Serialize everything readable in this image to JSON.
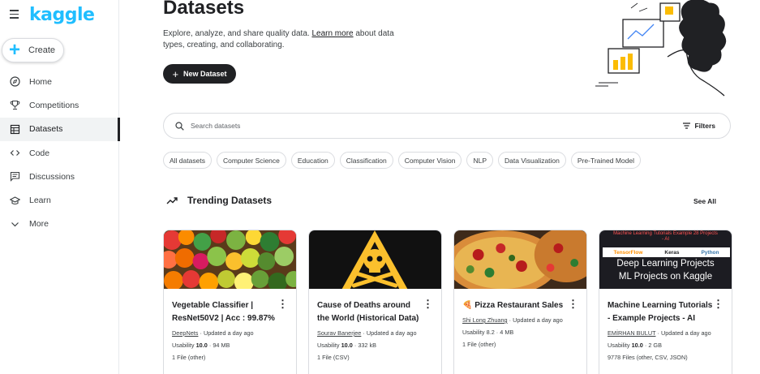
{
  "app": {
    "logo": "kaggle"
  },
  "sidebar": {
    "create_label": "Create",
    "items": [
      {
        "label": "Home",
        "icon": "compass-icon"
      },
      {
        "label": "Competitions",
        "icon": "trophy-icon"
      },
      {
        "label": "Datasets",
        "icon": "table-icon",
        "active": true
      },
      {
        "label": "Code",
        "icon": "code-icon"
      },
      {
        "label": "Discussions",
        "icon": "comment-icon"
      },
      {
        "label": "Learn",
        "icon": "graduation-cap-icon"
      },
      {
        "label": "More",
        "icon": "chevron-down-icon"
      }
    ]
  },
  "header": {
    "title": "Datasets",
    "desc_before": "Explore, analyze, and share quality data. ",
    "desc_link": "Learn more",
    "desc_after": " about data types, creating, and collaborating.",
    "new_dataset_label": "New Dataset"
  },
  "search": {
    "placeholder": "Search datasets",
    "filters_label": "Filters"
  },
  "chips": [
    "All datasets",
    "Computer Science",
    "Education",
    "Classification",
    "Computer Vision",
    "NLP",
    "Data Visualization",
    "Pre-Trained Model"
  ],
  "trending": {
    "title": "Trending Datasets",
    "see_all": "See All",
    "cards": [
      {
        "title": "Vegetable Classifier | ResNet50V2 | Acc : 99.87%",
        "author": "DeepNets",
        "updated": "Updated a day ago",
        "usability_label": "Usability",
        "usability": "10.0",
        "size": "94 MB",
        "files": "1 File (other)"
      },
      {
        "title": "Cause of Deaths around the World (Historical Data)",
        "author": "Sourav Banerjee",
        "updated": "Updated a day ago",
        "usability_label": "Usability",
        "usability": "10.0",
        "size": "332 kB",
        "files": "1 File (CSV)"
      },
      {
        "title": "🍕 Pizza Restaurant Sales",
        "author": "Shi Long Zhuang",
        "updated": "Updated a day ago",
        "usability_label": "Usability",
        "usability": "8.2",
        "size": "4 MB",
        "files": "1 File (other)"
      },
      {
        "title": "Machine Learning Tutorials - Example Projects - AI",
        "author": "EMİRHAN BULUT",
        "updated": "Updated a day ago",
        "usability_label": "Usability",
        "usability": "10.0",
        "size": "2 GB",
        "files": "9778 Files (other, CSV, JSON)",
        "thumb_top": "Machine Learning Tutorials Example 28 Projects - AI",
        "thumb_logos": [
          "TensorFlow",
          "Keras",
          "Python"
        ],
        "thumb_line1": "Deep Learning Projects",
        "thumb_line2": "ML Projects on Kaggle"
      }
    ]
  }
}
